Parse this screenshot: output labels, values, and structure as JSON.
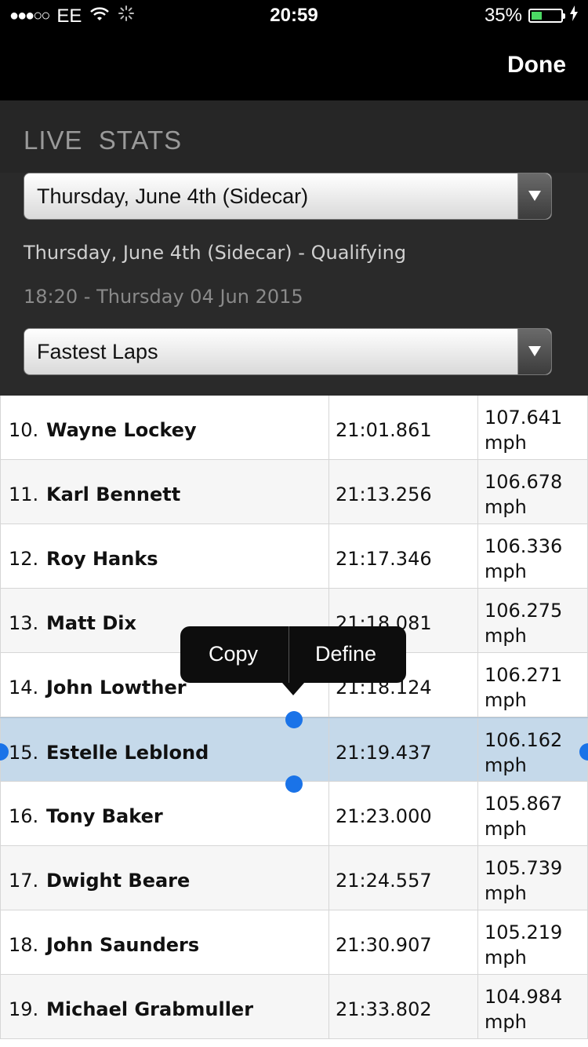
{
  "status_bar": {
    "signal": "●●●○○",
    "carrier": "EE",
    "wifi_icon": "wifi-icon",
    "activity_icon": "activity-spinner-icon",
    "time": "20:59",
    "battery_percent": "35%",
    "battery_level": 0.35
  },
  "nav": {
    "done_label": "Done"
  },
  "header": {
    "title": "LIVE STATS",
    "event_select": "Thursday, June 4th (Sidecar)",
    "session": "Thursday, June 4th (Sidecar) - Qualifying",
    "time": "18:20 - Thursday 04 Jun 2015",
    "type_select": "Fastest Laps"
  },
  "rows": [
    {
      "pos": "10.",
      "name": "Wayne Lockey",
      "time": "21:01.861",
      "speed": "107.641",
      "unit": "mph"
    },
    {
      "pos": "11.",
      "name": "Karl Bennett",
      "time": "21:13.256",
      "speed": "106.678",
      "unit": "mph"
    },
    {
      "pos": "12.",
      "name": "Roy Hanks",
      "time": "21:17.346",
      "speed": "106.336",
      "unit": "mph"
    },
    {
      "pos": "13.",
      "name": "Matt Dix",
      "time": "21:18.081",
      "speed": "106.275",
      "unit": "mph"
    },
    {
      "pos": "14.",
      "name": "John Lowther",
      "time": "21:18.124",
      "speed": "106.271",
      "unit": "mph"
    },
    {
      "pos": "15.",
      "name": "Estelle Leblond",
      "time": "21:19.437",
      "speed": "106.162",
      "unit": "mph"
    },
    {
      "pos": "16.",
      "name": "Tony Baker",
      "time": "21:23.000",
      "speed": "105.867",
      "unit": "mph"
    },
    {
      "pos": "17.",
      "name": "Dwight Beare",
      "time": "21:24.557",
      "speed": "105.739",
      "unit": "mph"
    },
    {
      "pos": "18.",
      "name": "John Saunders",
      "time": "21:30.907",
      "speed": "105.219",
      "unit": "mph"
    },
    {
      "pos": "19.",
      "name": "Michael Grabmuller",
      "time": "21:33.802",
      "speed": "104.984",
      "unit": "mph"
    }
  ],
  "context_menu": {
    "copy_label": "Copy",
    "define_label": "Define"
  },
  "colors": {
    "selection": "#c5d9ea",
    "handle": "#1a73e8",
    "battery": "#4cd964"
  }
}
